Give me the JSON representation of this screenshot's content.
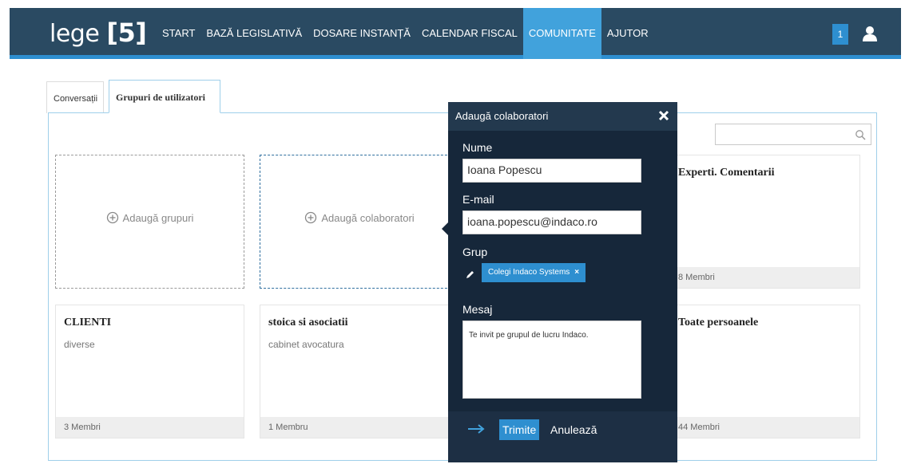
{
  "brand": {
    "word": "lege",
    "open_bracket": "[",
    "number": "5",
    "close_bracket": "]"
  },
  "nav": {
    "items": [
      {
        "label": "START",
        "active": false
      },
      {
        "label": "BAZĂ LEGISLATIVĂ",
        "active": false
      },
      {
        "label": "DOSARE INSTANȚĂ",
        "active": false
      },
      {
        "label": "CALENDAR FISCAL",
        "active": false
      },
      {
        "label": "COMUNITATE",
        "active": true
      },
      {
        "label": "AJUTOR",
        "active": false
      }
    ],
    "notification_count": "1",
    "user_icon": "user-icon"
  },
  "tabs": {
    "conversations": "Conversații",
    "groups": "Grupuri de utilizatori"
  },
  "search": {
    "placeholder": "",
    "icon": "search-icon"
  },
  "cards": {
    "add_groups": "Adaugă grupuri",
    "add_collaborators": "Adaugă colaboratori",
    "experts": {
      "title": "Experti. Comentarii",
      "members": "8 Membri"
    },
    "clienti": {
      "title": "CLIENTI",
      "subtitle": "diverse",
      "members": "3 Membri"
    },
    "stoica": {
      "title": "stoica si asociatii",
      "subtitle": "cabinet avocatura",
      "members": "1 Membru"
    },
    "toate": {
      "title": "Toate persoanele",
      "members": "44 Membri"
    }
  },
  "modal": {
    "title": "Adaugă colaboratori",
    "name_label": "Nume",
    "name_value": "Ioana Popescu",
    "email_label": "E-mail",
    "email_value": "ioana.popescu@indaco.ro",
    "group_label": "Grup",
    "group_chip": "Colegi Indaco Systems",
    "group_chip_remove": "×",
    "message_label": "Mesaj",
    "message_value": "Te invit pe grupul de lucru Indaco.",
    "send": "Trimite",
    "cancel": "Anulează"
  },
  "colors": {
    "nav_bg": "#2a4a62",
    "accent": "#2e8fd0",
    "active_menu": "#41a2dc",
    "modal_bg": "#16273a"
  }
}
